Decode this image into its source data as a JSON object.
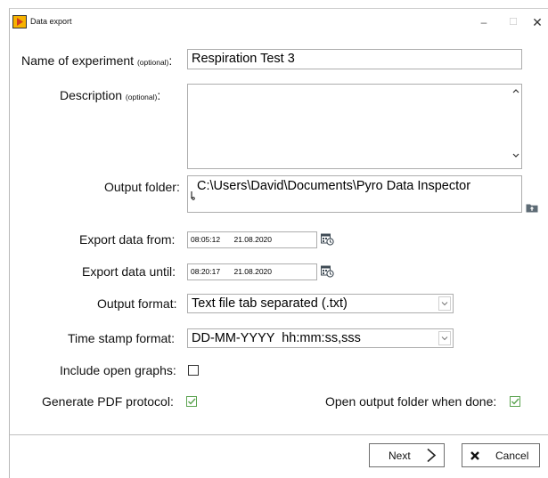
{
  "window": {
    "title": "Data export",
    "minimize_glyph": "–",
    "maximize_glyph": "☐",
    "close_glyph": "✕",
    "app_icon": "app-logo-icon",
    "accent_color": "#f7b200"
  },
  "form": {
    "experiment_name": {
      "label": "Name of experiment",
      "hint": "(optional)",
      "colon": ":",
      "value": "Respiration Test 3"
    },
    "description": {
      "label": "Description",
      "hint": "(optional)",
      "colon": ":",
      "value": ""
    },
    "output_folder": {
      "label": "Output folder:",
      "value": "C:\\Users\\David\\Documents\\Pyro Data Inspector",
      "browse_icon": "folder-upload-icon"
    },
    "export_from": {
      "label": "Export data from:",
      "time": "08:05:12",
      "date": "21.08.2020",
      "icon": "calendar-clock-icon"
    },
    "export_until": {
      "label": "Export data until:",
      "time": "08:20:17",
      "date": "21.08.2020",
      "icon": "calendar-clock-icon"
    },
    "output_format": {
      "label": "Output format:",
      "value": "Text file tab separated (.txt)"
    },
    "timestamp_format": {
      "label": "Time stamp format:",
      "value": "DD-MM-YYYY  hh:mm:ss,sss"
    },
    "include_open_graphs": {
      "label": "Include open graphs:",
      "checked": false
    },
    "generate_pdf": {
      "label": "Generate PDF protocol:",
      "checked": true
    },
    "open_folder": {
      "label": "Open output folder when done:",
      "checked": true
    },
    "check_color": "#5aa34f"
  },
  "buttons": {
    "next": {
      "label": "Next",
      "icon": "chevron-right-icon"
    },
    "cancel": {
      "label": "Cancel",
      "icon": "close-x-icon"
    }
  }
}
